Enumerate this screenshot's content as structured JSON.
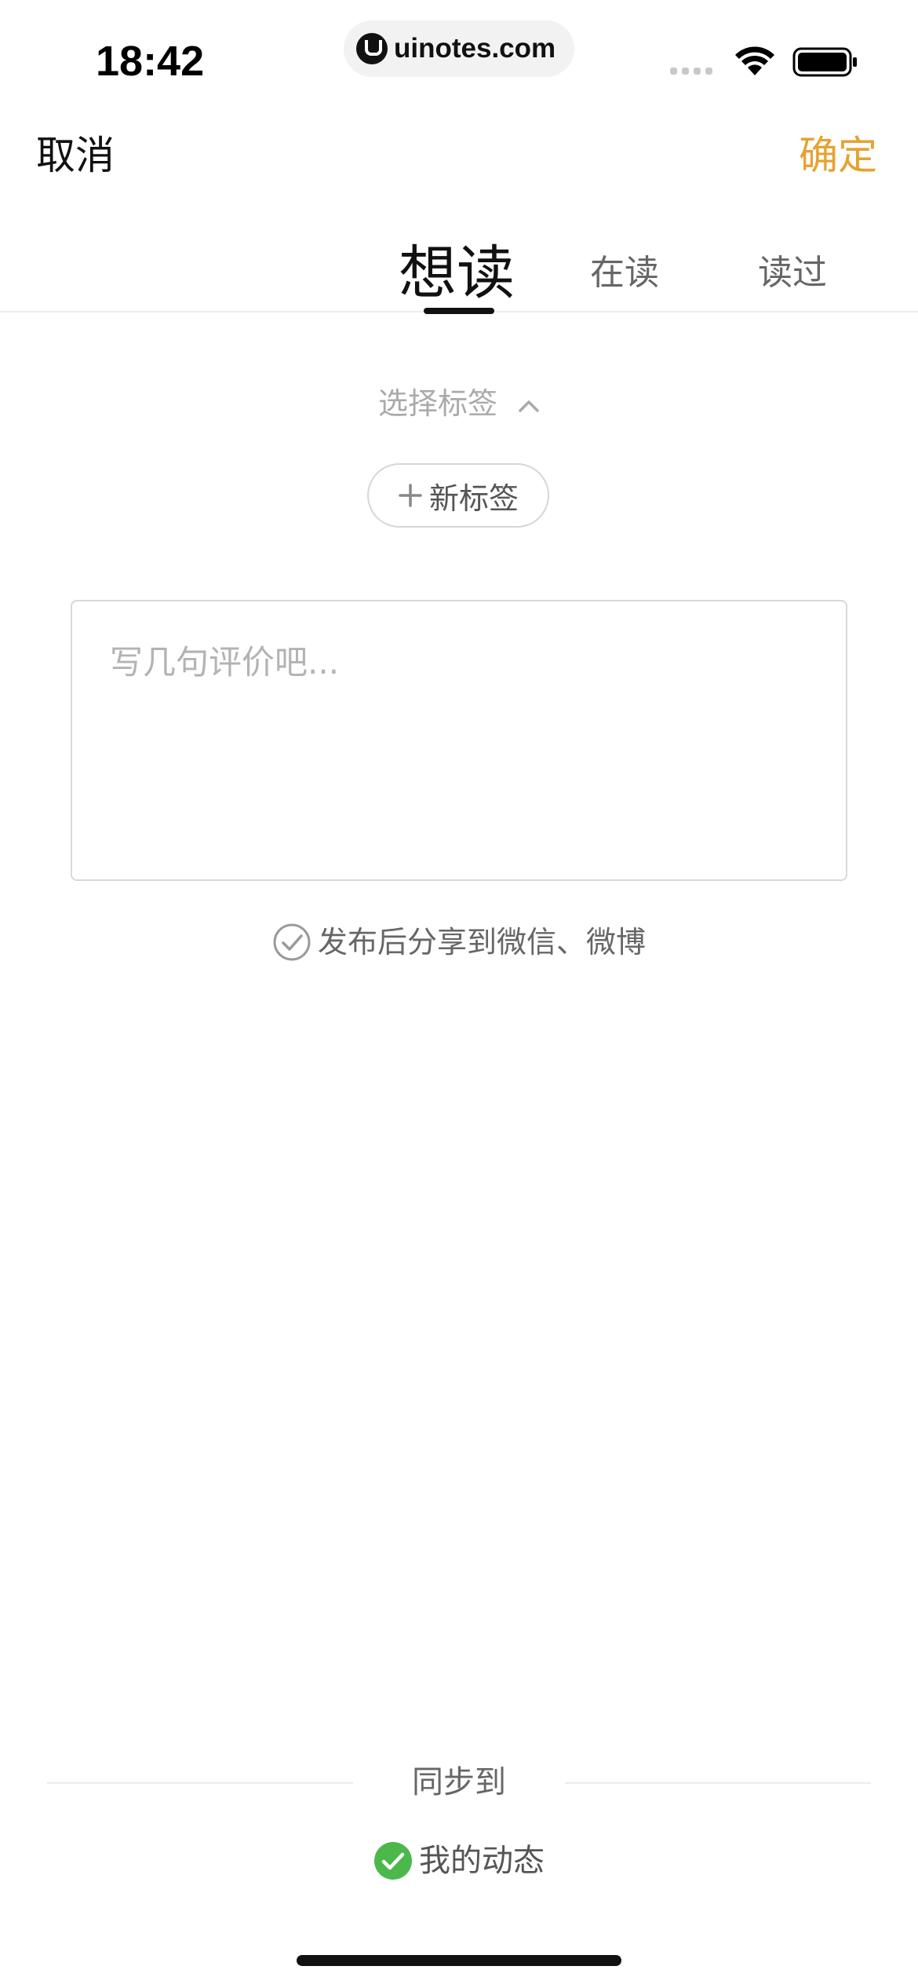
{
  "status_bar": {
    "time": "18:42",
    "url": "uinotes.com",
    "icons": [
      "signal-icon",
      "wifi-icon",
      "battery-icon"
    ]
  },
  "nav": {
    "cancel_label": "取消",
    "confirm_label": "确定",
    "confirm_color": "#e6a230"
  },
  "tabs": [
    {
      "label": "想读",
      "active": true
    },
    {
      "label": "在读",
      "active": false
    },
    {
      "label": "读过",
      "active": false
    }
  ],
  "tags": {
    "select_label": "选择标签",
    "select_icon": "chevron-up-icon",
    "new_tag_label": "新标签",
    "new_tag_icon": "plus-icon"
  },
  "review": {
    "placeholder": "写几句评价吧...",
    "value": ""
  },
  "share": {
    "label": "发布后分享到微信、微博",
    "icon": "check-circle-icon",
    "checked": false
  },
  "sync": {
    "title": "同步到",
    "option_label": "我的动态",
    "option_icon": "green-check-icon",
    "option_checked": true,
    "option_color": "#4cb84c"
  }
}
